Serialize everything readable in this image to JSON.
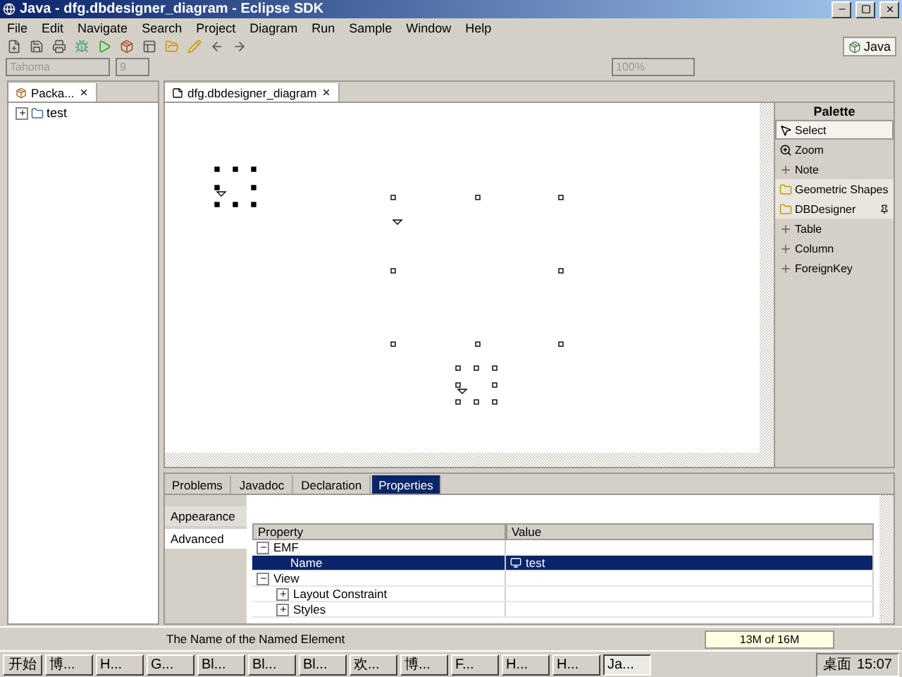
{
  "window": {
    "title": "Java - dfg.dbdesigner_diagram - Eclipse SDK"
  },
  "menu": [
    "File",
    "Edit",
    "Navigate",
    "Search",
    "Project",
    "Diagram",
    "Run",
    "Sample",
    "Window",
    "Help"
  ],
  "format_toolbar": {
    "font": "Tahoma",
    "size": "9",
    "zoom": "100%"
  },
  "perspective": {
    "label": "Java",
    "selected": true
  },
  "package_explorer": {
    "tab": "Packa...",
    "tree": [
      {
        "label": "test",
        "expanded": false
      }
    ]
  },
  "editor": {
    "tab": "dfg.dbdesigner_diagram"
  },
  "palette": {
    "title": "Palette",
    "items": [
      {
        "kind": "tool",
        "label": "Select",
        "selected": true
      },
      {
        "kind": "tool",
        "label": "Zoom",
        "selected": false
      },
      {
        "kind": "tool",
        "label": "Note",
        "selected": false
      },
      {
        "kind": "drawer",
        "label": "Geometric Shapes",
        "selected": false
      },
      {
        "kind": "drawer",
        "label": "DBDesigner",
        "selected": false
      },
      {
        "kind": "tool",
        "label": "Table",
        "selected": false
      },
      {
        "kind": "tool",
        "label": "Column",
        "selected": false
      },
      {
        "kind": "tool",
        "label": "ForeignKey",
        "selected": false
      }
    ]
  },
  "bottom_tabs": [
    {
      "label": "Problems",
      "selected": false
    },
    {
      "label": "Javadoc",
      "selected": false
    },
    {
      "label": "Declaration",
      "selected": false
    },
    {
      "label": "Properties",
      "selected": true
    }
  ],
  "properties": {
    "sections": [
      {
        "label": "Appearance",
        "selected": false
      },
      {
        "label": "Advanced",
        "selected": true
      }
    ],
    "columns": [
      "Property",
      "Value"
    ],
    "rows": [
      {
        "label": "EMF",
        "expanded": true,
        "selected": false,
        "children": [
          {
            "label": "Name",
            "value": "test",
            "selected": true
          }
        ]
      },
      {
        "label": "View",
        "expanded": true,
        "selected": false,
        "children": [
          {
            "label": "Layout Constraint",
            "expanded": false,
            "selected": false
          },
          {
            "label": "Styles",
            "expanded": false,
            "selected": false
          }
        ]
      }
    ]
  },
  "status_bar": {
    "message": "The Name of the Named Element",
    "memory": "13M of 16M"
  },
  "taskbar": {
    "start": "开始",
    "tasks": [
      {
        "label": "博...",
        "selected": false
      },
      {
        "label": "H...",
        "selected": false
      },
      {
        "label": "G...",
        "selected": false
      },
      {
        "label": "Bl...",
        "selected": false
      },
      {
        "label": "Bl...",
        "selected": false
      },
      {
        "label": "Bl...",
        "selected": false
      },
      {
        "label": "欢...",
        "selected": false
      },
      {
        "label": "博...",
        "selected": false
      },
      {
        "label": "F...",
        "selected": false
      },
      {
        "label": "H...",
        "selected": false
      },
      {
        "label": "H...",
        "selected": false
      },
      {
        "label": "Ja...",
        "selected": true
      }
    ],
    "tray_label": "桌面",
    "clock": "15:07"
  }
}
